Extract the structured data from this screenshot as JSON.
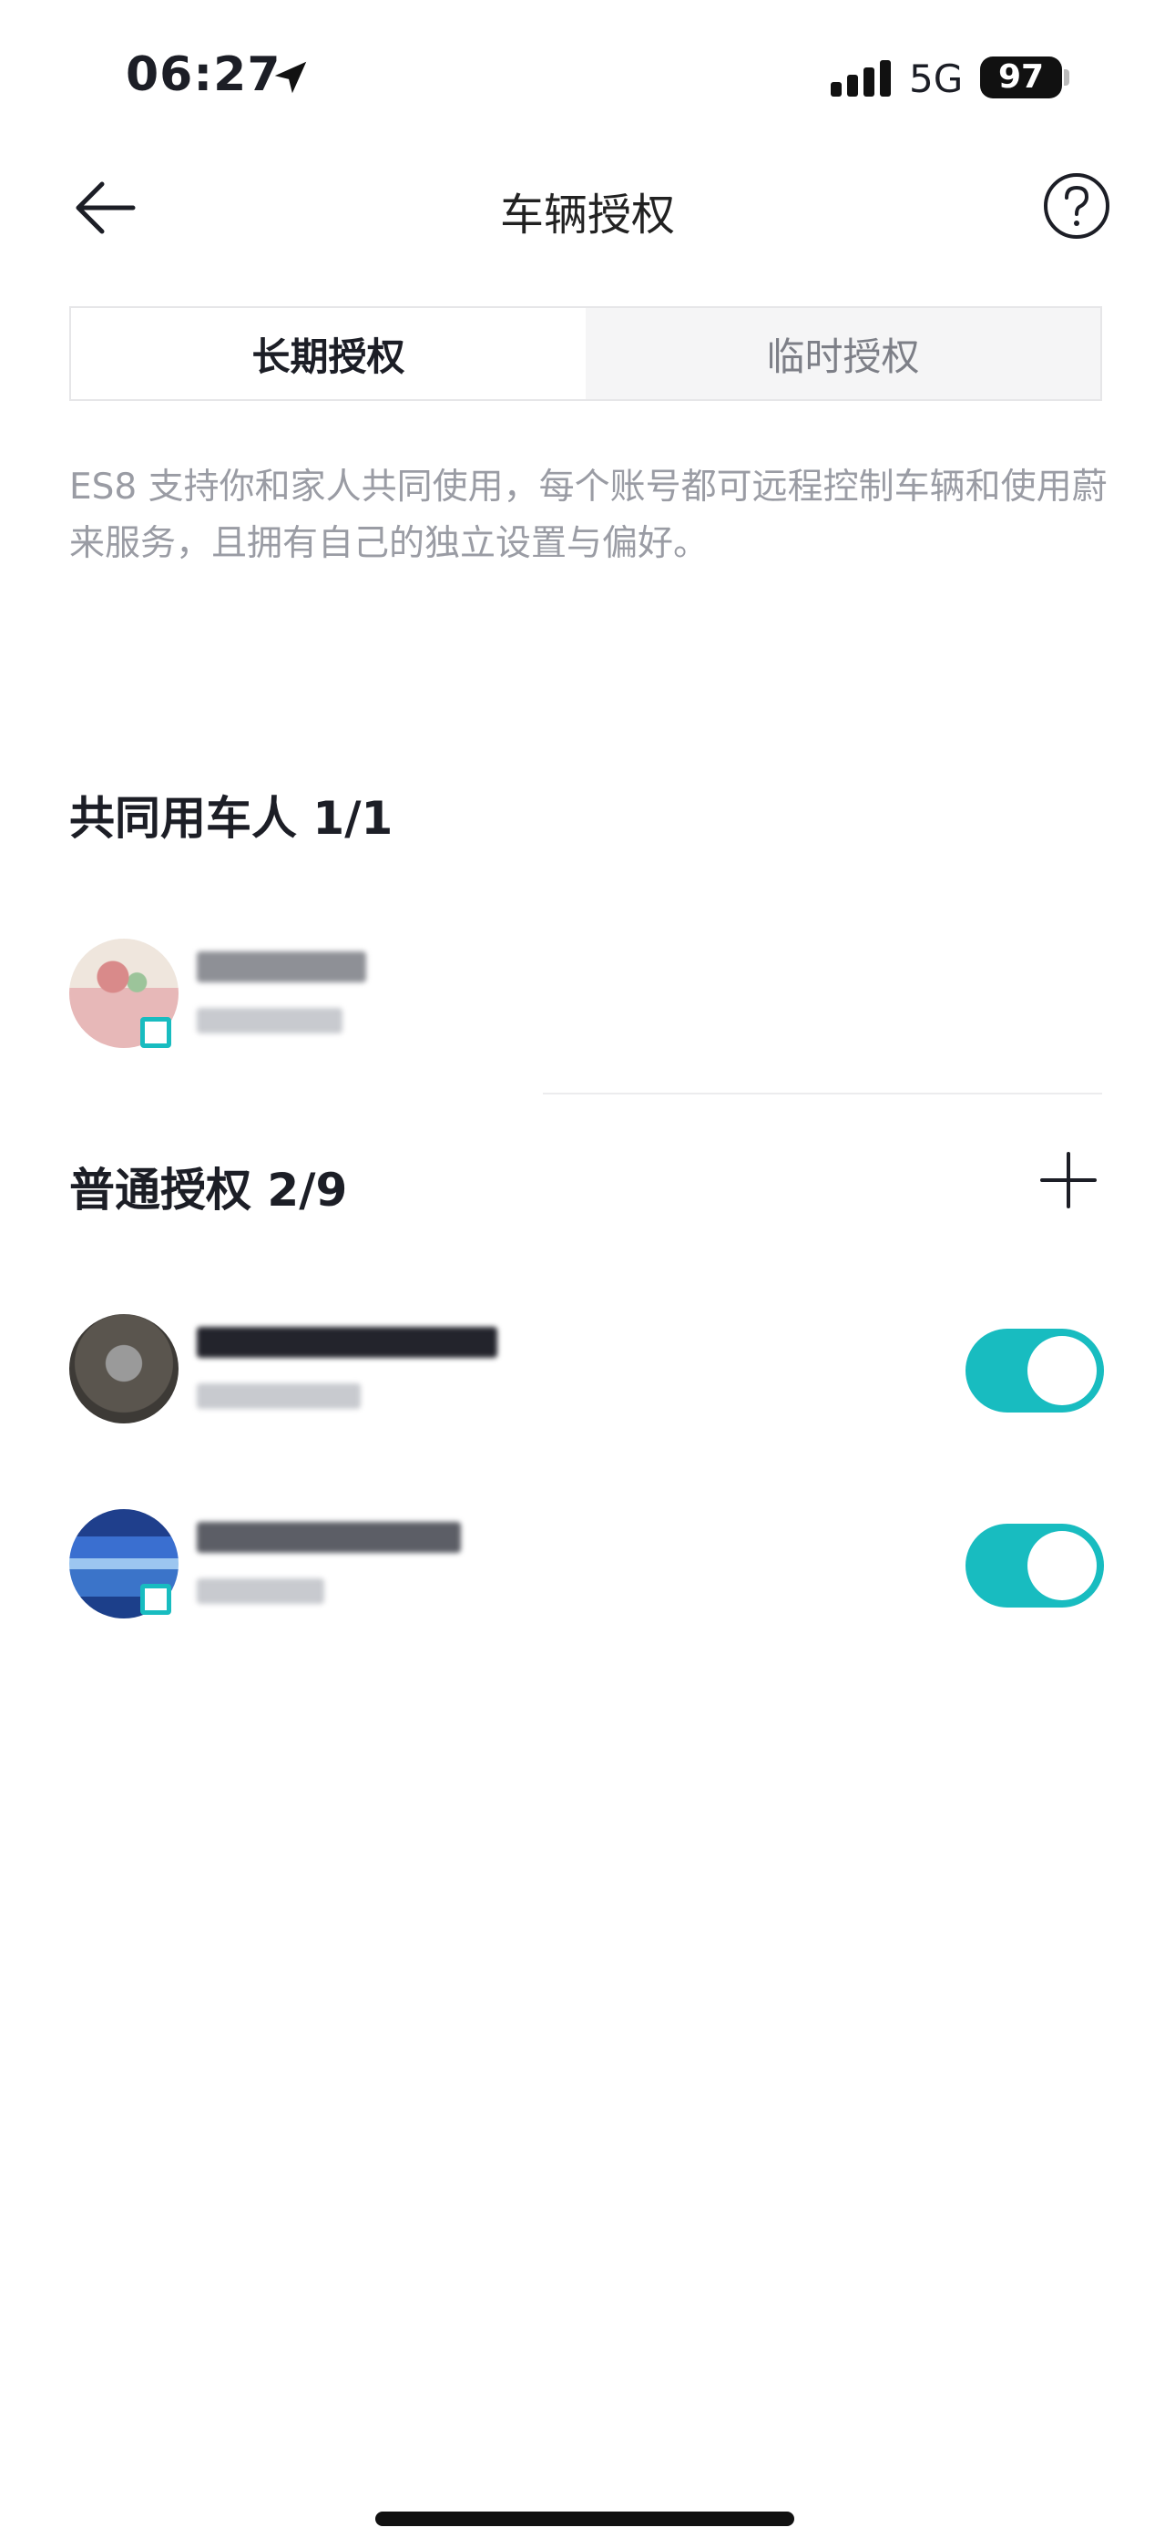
{
  "status_bar": {
    "time": "06:27",
    "network": "5G",
    "battery": "97"
  },
  "nav": {
    "title": "车辆授权"
  },
  "tabs": [
    {
      "label": "长期授权",
      "active": true
    },
    {
      "label": "临时授权",
      "active": false
    }
  ],
  "description": "ES8 支持你和家人共同使用，每个账号都可远程控制车辆和使用蔚来服务，且拥有自己的独立设置与偏好。",
  "shared_section": {
    "title": "共同用车人 1/1",
    "users": [
      {
        "name": "",
        "subtitle": ""
      }
    ]
  },
  "general_section": {
    "title": "普通授权 2/9",
    "users": [
      {
        "name": "",
        "subtitle": "",
        "enabled": true
      },
      {
        "name": "",
        "subtitle": "",
        "enabled": true
      }
    ]
  },
  "colors": {
    "accent": "#18bcc0",
    "text": "#1c1e26",
    "muted": "#9a9ca4"
  },
  "icons": [
    "location-arrow-icon",
    "signal-icon",
    "back-arrow-icon",
    "help-icon",
    "plus-icon"
  ]
}
